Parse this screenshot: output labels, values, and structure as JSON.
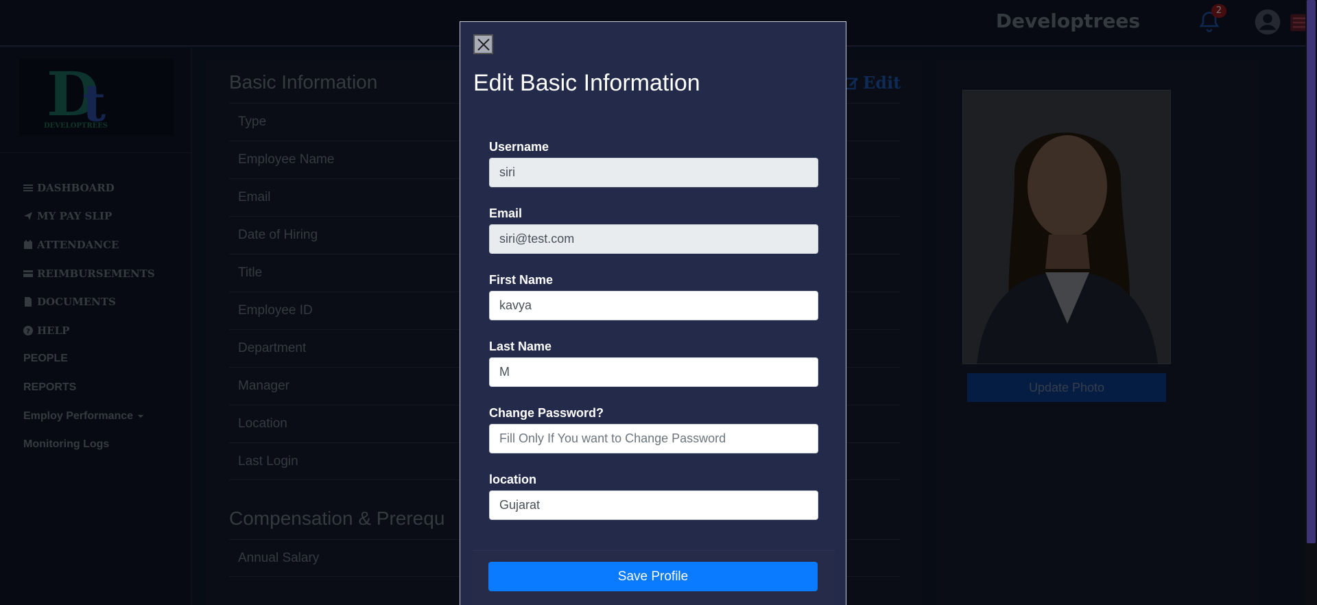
{
  "header": {
    "brand": "Developtrees",
    "notification_count": "2"
  },
  "sidebar": {
    "logo_alt": "DEVELOPTREES",
    "items": [
      {
        "label": "DASHBOARD",
        "icon": "bars-icon"
      },
      {
        "label": "MY PAY SLIP",
        "icon": "paper-plane-icon"
      },
      {
        "label": "ATTENDANCE",
        "icon": "calendar-icon"
      },
      {
        "label": "REIMBURSEMENTS",
        "icon": "credit-card-icon"
      },
      {
        "label": "DOCUMENTS",
        "icon": "file-icon"
      },
      {
        "label": "HELP",
        "icon": "question-circle-icon"
      },
      {
        "label": "PEOPLE"
      },
      {
        "label": "REPORTS"
      },
      {
        "label": "Employ Performance"
      },
      {
        "label": "Monitoring Logs"
      }
    ]
  },
  "profile": {
    "title": "Basic Information",
    "edit_label": "Edit",
    "fields": [
      "Type",
      "Employee Name",
      "Email",
      "Date of Hiring",
      "Title",
      "Employee ID",
      "Department",
      "Manager",
      "Location",
      "Last Login"
    ],
    "compensation_title": "Compensation & Prerequ",
    "compensation_fields": [
      "Annual Salary"
    ],
    "update_photo_label": "Update Photo"
  },
  "modal": {
    "title": "Edit Basic Information",
    "fields": [
      {
        "label": "Username",
        "value": "siri",
        "placeholder": "",
        "readonly": true
      },
      {
        "label": "Email",
        "value": "siri@test.com",
        "placeholder": "",
        "readonly": true
      },
      {
        "label": "First Name",
        "value": "kavya",
        "placeholder": "",
        "readonly": false
      },
      {
        "label": "Last Name",
        "value": "M",
        "placeholder": "",
        "readonly": false
      },
      {
        "label": "Change Password?",
        "value": "",
        "placeholder": "Fill Only If You want to Change Password",
        "readonly": false
      },
      {
        "label": "location",
        "value": "Gujarat",
        "placeholder": "",
        "readonly": false
      }
    ],
    "save_label": "Save Profile"
  },
  "colors": {
    "accent": "#0a7bff",
    "modal_bg": "#242a4a",
    "scroll_thumb": "#7b68ee"
  }
}
